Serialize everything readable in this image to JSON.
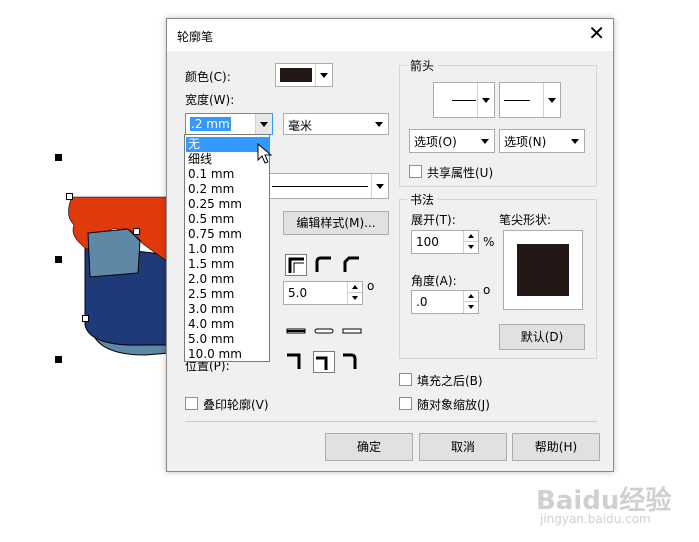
{
  "dialog": {
    "title": "轮廓笔",
    "close_glyph": "✕",
    "color_label": "颜色(C):",
    "width_label": "宽度(W):",
    "width_value": ".2 mm",
    "unit_value": "毫米",
    "width_options": [
      "无",
      "细线",
      "0.1 mm",
      "0.2 mm",
      "0.25 mm",
      "0.5 mm",
      "0.75 mm",
      "1.0 mm",
      "1.5 mm",
      "2.0 mm",
      "2.5 mm",
      "3.0 mm",
      "4.0 mm",
      "5.0 mm",
      "10.0 mm"
    ],
    "highlighted_option": "无",
    "edit_style_button": "编辑样式(M)...",
    "miter_value": "5.0",
    "degree_glyph": "o",
    "position_label": "位置(P):",
    "overprint_label": "叠印轮廓(V)",
    "arrows": {
      "title": "箭头",
      "options_left": "选项(O)",
      "options_right": "选项(N)",
      "share_label": "共享属性(U)"
    },
    "calligraphy": {
      "title": "书法",
      "stretch_label": "展开(T):",
      "stretch_value": "100",
      "percent": "%",
      "angle_label": "角度(A):",
      "angle_value": ".0",
      "nib_label": "笔尖形状:",
      "default_button": "默认(D)"
    },
    "behind_fill_label": "填充之后(B)",
    "scale_label": "随对象缩放(J)",
    "ok_button": "确定",
    "cancel_button": "取消",
    "help_button": "帮助(H)",
    "colors": {
      "swatch": "#231815",
      "highlight": "#3399ff"
    }
  },
  "watermark": {
    "brand": "Baidu经验",
    "url": "jingyan.baidu.com"
  }
}
